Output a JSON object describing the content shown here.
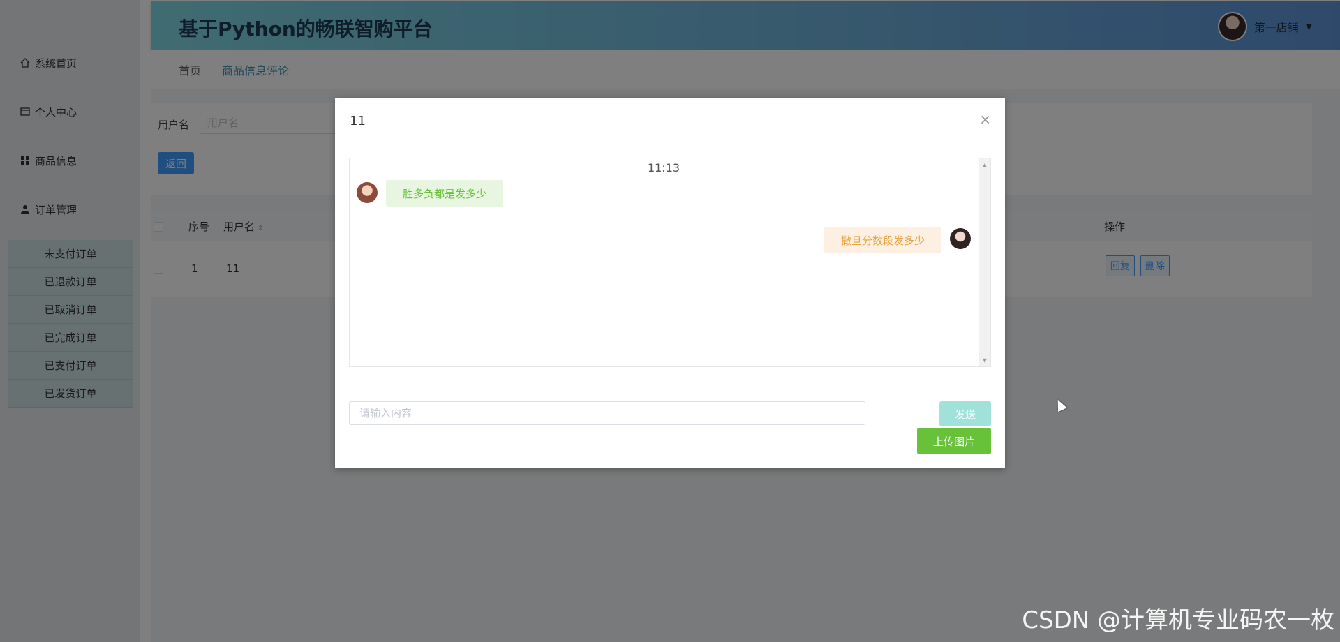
{
  "header": {
    "app_title": "基于Python的畅联智购平台",
    "user_name": "第一店铺",
    "user_menu_icon": "caret-down-icon"
  },
  "sidebar": {
    "items": [
      {
        "label": "系统首页",
        "icon": "home-icon"
      },
      {
        "label": "个人中心",
        "icon": "card-icon"
      },
      {
        "label": "商品信息",
        "icon": "grid-icon"
      },
      {
        "label": "订单管理",
        "icon": "user-icon"
      }
    ],
    "submenu": [
      {
        "label": "未支付订单"
      },
      {
        "label": "已退款订单"
      },
      {
        "label": "已取消订单"
      },
      {
        "label": "已完成订单"
      },
      {
        "label": "已支付订单"
      },
      {
        "label": "已发货订单"
      }
    ]
  },
  "breadcrumb": {
    "home": "首页",
    "current": "商品信息评论"
  },
  "search": {
    "label": "用户名",
    "placeholder": "用户名",
    "back_label": "返回"
  },
  "table": {
    "columns": [
      "序号",
      "用户名",
      "操作"
    ],
    "rows": [
      {
        "index": "1",
        "username": "11",
        "actions": [
          "回复",
          "删除"
        ]
      }
    ]
  },
  "dialog": {
    "title": "11",
    "close_symbol": "×",
    "chat": {
      "time": "11:13",
      "messages": [
        {
          "side": "left",
          "text": "胜多负都是发多少"
        },
        {
          "side": "right",
          "text": "撒旦分数段发多少"
        }
      ]
    },
    "input_placeholder": "请输入内容",
    "send_label": "发送",
    "upload_label": "上传图片"
  },
  "watermark": "CSDN @计算机专业码农一枚",
  "colors": {
    "primary": "#409eff",
    "success": "#67c23a",
    "warning": "#e6a23c",
    "send_button": "#a0e1d9"
  }
}
